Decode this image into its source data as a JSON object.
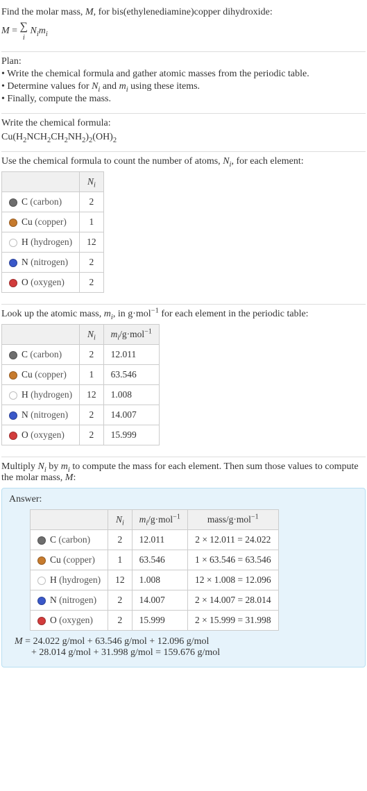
{
  "intro": {
    "line1_prefix": "Find the molar mass, ",
    "line1_m": "M",
    "line1_suffix": ", for bis(ethylenediamine)copper dihydroxide:",
    "eq_m": "M",
    "eq_equals": " = ",
    "eq_sum_idx": "i",
    "eq_ni": "N",
    "eq_mi": "m"
  },
  "plan": {
    "title": "Plan:",
    "b1": "• Write the chemical formula and gather atomic masses from the periodic table.",
    "b2_pre": "• Determine values for ",
    "b2_and": " and ",
    "b2_post": " using these items.",
    "b3": "• Finally, compute the mass."
  },
  "formula": {
    "title": "Write the chemical formula:",
    "p1": "Cu(H",
    "s1": "2",
    "p2": "NCH",
    "s2": "2",
    "p3": "CH",
    "s3": "2",
    "p4": "NH",
    "s4": "2",
    "p5": ")",
    "s5": "2",
    "p6": "(OH)",
    "s6": "2"
  },
  "count": {
    "title_pre": "Use the chemical formula to count the number of atoms, ",
    "title_post": ", for each element:",
    "hdr_ni": "N",
    "rows": [
      {
        "color": "#6e6e6e",
        "sym": "C",
        "name": "(carbon)",
        "n": "2"
      },
      {
        "color": "#c77b2e",
        "sym": "Cu",
        "name": "(copper)",
        "n": "1"
      },
      {
        "color": "#ffffff",
        "sym": "H",
        "name": "(hydrogen)",
        "n": "12"
      },
      {
        "color": "#3a58c9",
        "sym": "N",
        "name": "(nitrogen)",
        "n": "2"
      },
      {
        "color": "#d23c3c",
        "sym": "O",
        "name": "(oxygen)",
        "n": "2"
      }
    ]
  },
  "masses": {
    "title_pre": "Look up the atomic mass, ",
    "title_mid": ", in g·mol",
    "title_sup": "−1",
    "title_post": " for each element in the periodic table:",
    "hdr_mi_pre": "m",
    "hdr_mi_unit": "/g·mol",
    "rows": [
      {
        "color": "#6e6e6e",
        "sym": "C",
        "name": "(carbon)",
        "n": "2",
        "m": "12.011"
      },
      {
        "color": "#c77b2e",
        "sym": "Cu",
        "name": "(copper)",
        "n": "1",
        "m": "63.546"
      },
      {
        "color": "#ffffff",
        "sym": "H",
        "name": "(hydrogen)",
        "n": "12",
        "m": "1.008"
      },
      {
        "color": "#3a58c9",
        "sym": "N",
        "name": "(nitrogen)",
        "n": "2",
        "m": "14.007"
      },
      {
        "color": "#d23c3c",
        "sym": "O",
        "name": "(oxygen)",
        "n": "2",
        "m": "15.999"
      }
    ]
  },
  "mult": {
    "text_pre": "Multiply ",
    "text_by": " by ",
    "text_mid": " to compute the mass for each element. Then sum those values to compute the molar mass, ",
    "text_post": ":"
  },
  "answer": {
    "title": "Answer:",
    "hdr_mass_pre": "mass/g·mol",
    "rows": [
      {
        "color": "#6e6e6e",
        "sym": "C",
        "name": "(carbon)",
        "n": "2",
        "m": "12.011",
        "calc": "2 × 12.011 = 24.022"
      },
      {
        "color": "#c77b2e",
        "sym": "Cu",
        "name": "(copper)",
        "n": "1",
        "m": "63.546",
        "calc": "1 × 63.546 = 63.546"
      },
      {
        "color": "#ffffff",
        "sym": "H",
        "name": "(hydrogen)",
        "n": "12",
        "m": "1.008",
        "calc": "12 × 1.008 = 12.096"
      },
      {
        "color": "#3a58c9",
        "sym": "N",
        "name": "(nitrogen)",
        "n": "2",
        "m": "14.007",
        "calc": "2 × 14.007 = 28.014"
      },
      {
        "color": "#d23c3c",
        "sym": "O",
        "name": "(oxygen)",
        "n": "2",
        "m": "15.999",
        "calc": "2 × 15.999 = 31.998"
      }
    ],
    "final_l1": "M = 24.022 g/mol + 63.546 g/mol + 12.096 g/mol",
    "final_l2": "+ 28.014 g/mol + 31.998 g/mol = 159.676 g/mol"
  }
}
